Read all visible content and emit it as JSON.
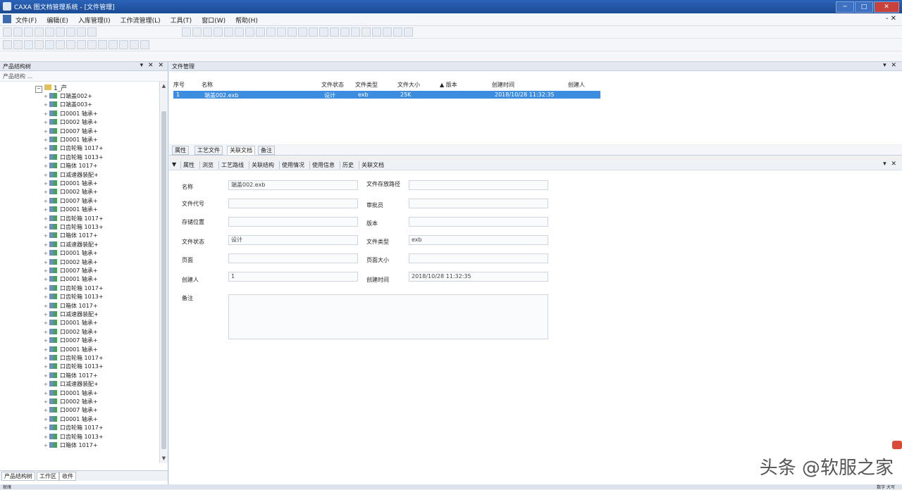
{
  "window": {
    "title": "CAXA 图文档管理系统 - [文件管理]",
    "controls": [
      "─",
      "□",
      "✕"
    ]
  },
  "menubar": {
    "items": [
      "文件(F)",
      "编辑(E)",
      "入库管理(I)",
      "工作流管理(L)",
      "工具(T)",
      "窗口(W)",
      "帮助(H)"
    ],
    "mdi_close": "- ✕"
  },
  "left_panel": {
    "header": "产品结构树",
    "controls": "▾ ✕ ✕",
    "toolbar_text": "产品结构 ...",
    "root": "1_产",
    "nodes": [
      "口端盖002+",
      "口端盖003+",
      "口0001 轴承+",
      "口0002 轴承+",
      "口0007 轴承+",
      "口0001 轴承+",
      "口齿轮箱 1017+",
      "口齿轮箱 1013+",
      "口箱体 1017+",
      "口减速器装配+",
      "口0001 轴承+",
      "口0002 轴承+",
      "口0007 轴承+",
      "口0001 轴承+",
      "口齿轮箱 1017+",
      "口齿轮箱 1013+",
      "口箱体 1017+",
      "口减速器装配+",
      "口0001 轴承+",
      "口0002 轴承+",
      "口0007 轴承+",
      "口0001 轴承+",
      "口齿轮箱 1017+",
      "口齿轮箱 1013+",
      "口箱体 1017+",
      "口减速器装配+",
      "口0001 轴承+",
      "口0002 轴承+",
      "口0007 轴承+",
      "口0001 轴承+",
      "口齿轮箱 1017+",
      "口齿轮箱 1013+",
      "口箱体 1017+",
      "口减速器装配+",
      "口0001 轴承+",
      "口0002 轴承+",
      "口0007 轴承+",
      "口0001 轴承+",
      "口齿轮箱 1017+",
      "口齿轮箱 1013+",
      "口箱体 1017+"
    ],
    "tabs": [
      "产品结构树",
      "工作区",
      "收件"
    ]
  },
  "right_panel": {
    "header": "文件管理",
    "controls": "▾ ✕",
    "grid": {
      "columns": [
        "序号",
        "名称",
        "文件状态",
        "文件类型",
        "文件大小",
        "▲ 版本",
        "创建时间",
        "创建人"
      ],
      "row": [
        "1",
        "端盖002.exb",
        "设计",
        "exb",
        "25K",
        "",
        "2018/10/28 11:32:35",
        ""
      ]
    },
    "tabs": [
      "属性",
      "工艺文件",
      "关联文档",
      "备注"
    ],
    "active_tab": 2
  },
  "detail": {
    "toolbar": [
      "属性",
      "浏览",
      "工艺路线",
      "关联结构",
      "使用情况",
      "使用信息",
      "历史",
      "关联文档"
    ],
    "controls": "▾ ✕",
    "fields": {
      "name_label": "名称",
      "name_value": "端盖002.exb",
      "path_label": "文件存放路径",
      "path_value": "",
      "code_label": "文件代号",
      "code_value": "",
      "checker_label": "审批员",
      "checker_value": "",
      "location_label": "存储位置",
      "location_value": "",
      "version_label": "版本",
      "version_value": "",
      "state_label": "文件状态",
      "state_value": "设计",
      "type_label": "文件类型",
      "type_value": "exb",
      "pages_label": "页面",
      "pages_value": "",
      "size_label": "页面大小",
      "size_value": "",
      "creator_label": "创建人",
      "creator_value": "1",
      "time_label": "创建时间",
      "time_value": "2018/10/28 11:32:35",
      "remark_label": "备注",
      "remark_value": ""
    }
  },
  "statusbar": {
    "left": "就绪",
    "right": "数字  大写"
  },
  "watermark": "头条 @软服之家",
  "colors": {
    "titlebar": "#1b4a93",
    "selection": "#3c8ce0",
    "close": "#c8423b"
  }
}
